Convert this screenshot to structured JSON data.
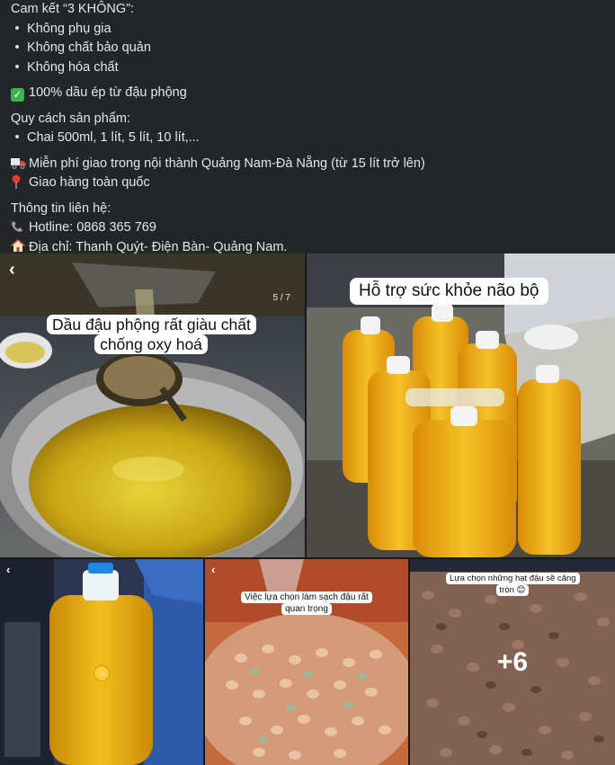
{
  "post": {
    "commit_title": "Cam kết “3 KHÔNG”:",
    "commit_items": [
      "Không phụ gia",
      "Không chất bảo quản",
      "Không hóa chất"
    ],
    "pure_line": "100% dầu ép từ đậu phộng",
    "spec_title": "Quy cách sản phẩm:",
    "spec_item": "Chai 500ml, 1 lít, 5 lít, 10 lít,...",
    "shipping_free": "Miễn phí giao trong nội thành Quảng Nam-Đà Nẵng (từ 15 lít trở lên)",
    "shipping_nation": "Giao hàng toàn quốc",
    "contact_title": "Thông tin liên hệ:",
    "hotline": "Hotline: 0868 365 769",
    "address": "Địa chỉ: Thanh Quýt- Điện Bàn- Quảng Nam."
  },
  "gallery": {
    "tile1": {
      "caption": "Dầu đậu phộng rất giàu chất chống oxy hoá",
      "counter": "5 / 7"
    },
    "tile2": {
      "caption": "Hỗ trợ sức khỏe não bộ"
    },
    "tile4": {
      "caption": "Việc lựa chọn làm sạch đậu rất quan trọng"
    },
    "tile5": {
      "caption": "Lựa chọn những hạt đậu sẽ căng tròn 😊",
      "more_count": "+6"
    }
  },
  "icons": {
    "check": "check-mark-button-icon",
    "truck": "delivery-truck-icon",
    "pin": "map-pin-icon",
    "phone": "telephone-icon",
    "house": "house-icon",
    "back": "chevron-left-icon"
  },
  "colors": {
    "background": "#242526",
    "text": "#e4e6eb",
    "check_green": "#3bb44a"
  }
}
